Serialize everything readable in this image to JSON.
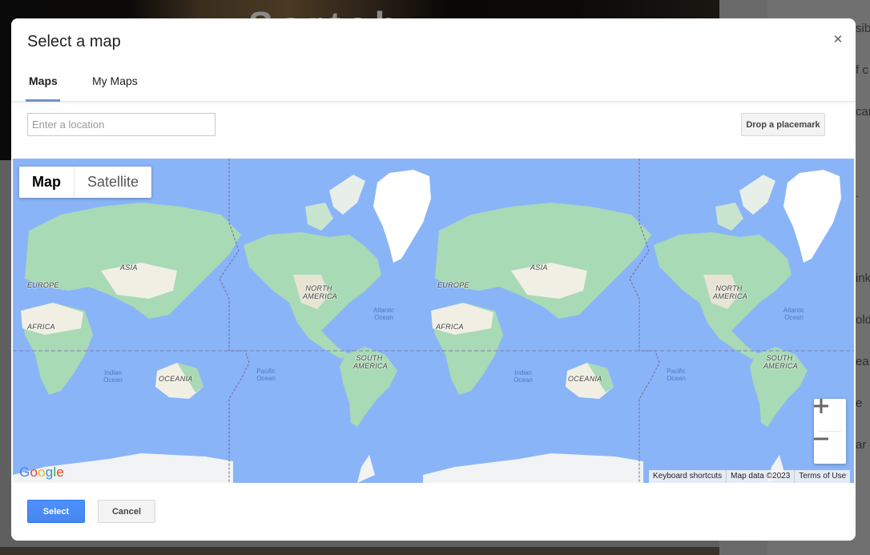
{
  "background": {
    "hero_text": "Sortab",
    "side_fragments": [
      "sibl",
      "f c",
      "car",
      ".",
      "ink",
      "old",
      "ea",
      "e",
      "ar"
    ]
  },
  "dialog": {
    "title": "Select a map",
    "close_icon": "close-icon",
    "tabs": [
      {
        "label": "Maps",
        "active": true
      },
      {
        "label": "My Maps",
        "active": false
      }
    ],
    "search": {
      "placeholder": "Enter a location",
      "value": ""
    },
    "drop_placemark_label": "Drop a placemark",
    "map": {
      "type_options": [
        {
          "label": "Map",
          "active": true
        },
        {
          "label": "Satellite",
          "active": false
        }
      ],
      "continent_labels": [
        "ASIA",
        "EUROPE",
        "AFRICA",
        "OCEANIA",
        "NORTH AMERICA",
        "SOUTH AMERICA",
        "ASIA",
        "EUROPE",
        "AFRICA",
        "OCEANIA",
        "NORTH AMERICA",
        "SOUTH AMERICA"
      ],
      "ocean_labels": [
        "Indian Ocean",
        "Pacific Ocean",
        "Atlantic Ocean",
        "Indian Ocean",
        "Pacific Ocean",
        "Atlantic Ocean"
      ],
      "zoom_in_icon": "plus-icon",
      "zoom_out_icon": "minus-icon",
      "logo_text": "Google",
      "attribution": {
        "keyboard_shortcuts": "Keyboard shortcuts",
        "map_data": "Map data ©2023",
        "terms": "Terms of Use"
      },
      "colors": {
        "water": "#8ab4f8",
        "land": "#a8dab5",
        "desert": "#f1efe4",
        "ice": "#ffffff"
      }
    },
    "footer": {
      "select_label": "Select",
      "cancel_label": "Cancel"
    }
  }
}
